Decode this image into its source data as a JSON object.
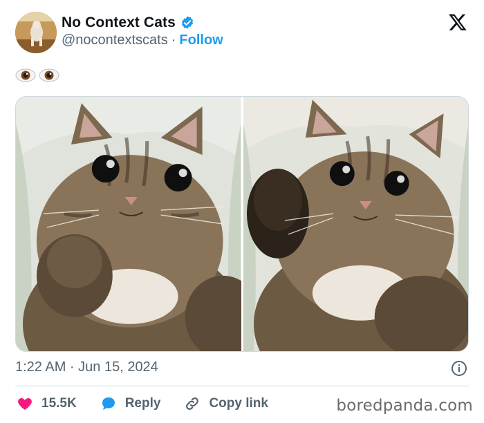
{
  "header": {
    "display_name": "No Context Cats",
    "handle": "@nocontextscats",
    "separator": "·",
    "follow_label": "Follow",
    "verified_color": "#1d9bf0",
    "avatar_icon": "cat-avatar",
    "logo_icon": "x-logo-icon"
  },
  "tweet": {
    "emoji": [
      "eyes-emoji",
      "eyes-emoji"
    ]
  },
  "media": {
    "photos": [
      {
        "name": "cat-photo-left",
        "description_icon": "cat-photo"
      },
      {
        "name": "cat-photo-right",
        "description_icon": "cat-photo"
      }
    ]
  },
  "meta": {
    "timestamp": "1:22 AM · Jun 15, 2024",
    "info_icon": "info-icon"
  },
  "actions": {
    "like_count": "15.5K",
    "reply_label": "Reply",
    "copy_label": "Copy link",
    "like_color": "#f91880",
    "reply_color": "#1d9bf0"
  },
  "watermark": "boredpanda.com"
}
